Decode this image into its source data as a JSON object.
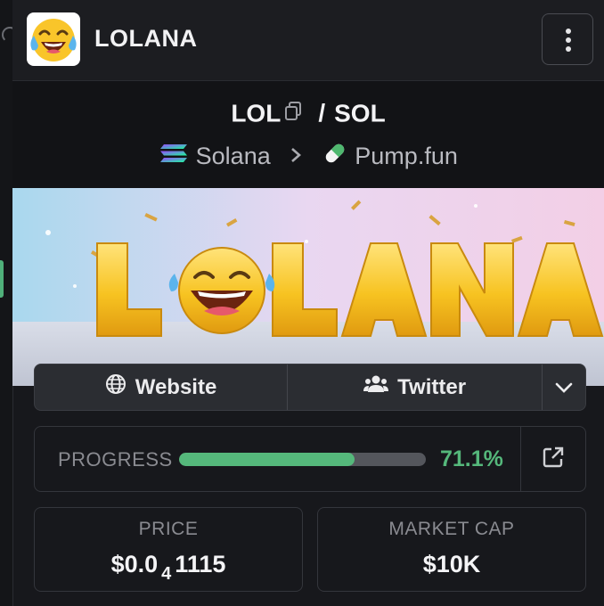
{
  "header": {
    "token_name": "LOLANA",
    "logo_icon": "crying-laughing-emoji-icon",
    "menu_icon": "vertical-dots-icon"
  },
  "pair": {
    "base": "LOL",
    "separator": "/",
    "quote": "SOL",
    "copy_icon": "copy-icon"
  },
  "breadcrumb": {
    "chain": "Solana",
    "chain_icon": "solana-icon",
    "sep_icon": "chevron-right-icon",
    "dex": "Pump.fun",
    "dex_icon": "pill-icon"
  },
  "banner": {
    "text": "LOLANA"
  },
  "links": {
    "website": "Website",
    "twitter": "Twitter",
    "website_icon": "globe-icon",
    "twitter_icon": "users-icon",
    "more_icon": "chevron-down-icon"
  },
  "progress": {
    "label": "PROGRESS",
    "value": "71.1%",
    "fraction": 0.711,
    "ext_icon": "external-link-icon",
    "colors": {
      "fill": "#55b87b",
      "track": "#54565c"
    }
  },
  "stats": {
    "price": {
      "label": "PRICE",
      "prefix": "$0.0",
      "zeros": "4",
      "suffix": "1115"
    },
    "market_cap": {
      "label": "MARKET CAP",
      "value": "$10K"
    }
  }
}
